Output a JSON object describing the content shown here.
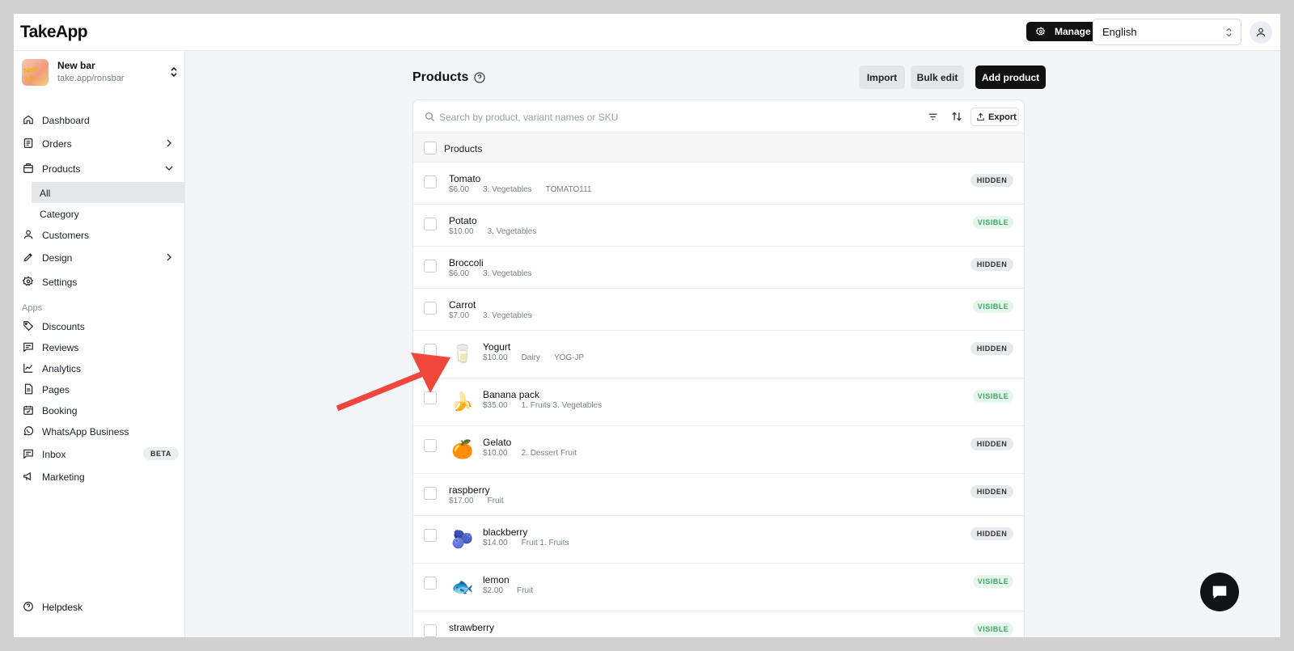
{
  "app": {
    "logo": "TakeApp"
  },
  "topbar": {
    "manage_label": "Manage",
    "language": "English"
  },
  "store": {
    "name": "New bar",
    "url": "take.app/ronsbar",
    "avatar_text": "New bar"
  },
  "sidebar": {
    "items": [
      {
        "label": "Dashboard",
        "icon": "home-icon"
      },
      {
        "label": "Orders",
        "icon": "orders-icon"
      },
      {
        "label": "Products",
        "icon": "products-icon"
      },
      {
        "label": "Customers",
        "icon": "user-icon"
      },
      {
        "label": "Design",
        "icon": "pen-icon"
      },
      {
        "label": "Settings",
        "icon": "gear-icon"
      }
    ],
    "sub_items": [
      {
        "label": "All"
      },
      {
        "label": "Category"
      }
    ],
    "apps_label": "Apps",
    "apps": [
      {
        "label": "Discounts",
        "icon": "tag-icon"
      },
      {
        "label": "Reviews",
        "icon": "review-icon"
      },
      {
        "label": "Analytics",
        "icon": "chart-icon"
      },
      {
        "label": "Pages",
        "icon": "page-icon"
      },
      {
        "label": "Booking",
        "icon": "calendar-icon"
      },
      {
        "label": "WhatsApp Business",
        "icon": "whatsapp-icon"
      },
      {
        "label": "Inbox",
        "icon": "inbox-icon",
        "badge": "BETA"
      },
      {
        "label": "Marketing",
        "icon": "megaphone-icon"
      }
    ],
    "helpdesk": "Helpdesk"
  },
  "main": {
    "title": "Products",
    "import_label": "Import",
    "bulk_edit_label": "Bulk edit",
    "add_product_label": "Add product",
    "search_placeholder": "Search by product, variant names or SKU",
    "export_label": "Export",
    "column_header": "Products",
    "products": [
      {
        "name": "Tomato",
        "price": "$6.00",
        "categories": "3. Vegetables",
        "sku": "TOMATO111",
        "status": "HIDDEN"
      },
      {
        "name": "Potato",
        "price": "$10.00",
        "categories": "3. Vegetables",
        "sku": "",
        "status": "VISIBLE"
      },
      {
        "name": "Broccoli",
        "price": "$6.00",
        "categories": "3. Vegetables",
        "sku": "",
        "status": "HIDDEN"
      },
      {
        "name": "Carrot",
        "price": "$7.00",
        "categories": "3. Vegetables",
        "sku": "",
        "status": "VISIBLE"
      },
      {
        "name": "Yogurt",
        "price": "$10.00",
        "categories": "Dairy",
        "sku": "YOG-JP",
        "status": "HIDDEN",
        "thumb": "🥛"
      },
      {
        "name": "Banana pack",
        "price": "$35.00",
        "categories": "1. Fruits 3. Vegetables",
        "sku": "",
        "status": "VISIBLE",
        "thumb": "🍌"
      },
      {
        "name": "Gelato",
        "price": "$10.00",
        "categories": "2. Dessert Fruit",
        "sku": "",
        "status": "HIDDEN",
        "thumb": "🍊"
      },
      {
        "name": "raspberry",
        "price": "$17.00",
        "categories": "Fruit",
        "sku": "",
        "status": "HIDDEN"
      },
      {
        "name": "blackberry",
        "price": "$14.00",
        "categories": "Fruit 1. Fruits",
        "sku": "",
        "status": "HIDDEN",
        "thumb": "🫐"
      },
      {
        "name": "lemon",
        "price": "$2.00",
        "categories": "Fruit",
        "sku": "",
        "status": "VISIBLE",
        "thumb": "🐟"
      },
      {
        "name": "strawberry",
        "price": "",
        "categories": "",
        "sku": "",
        "status": "VISIBLE"
      }
    ]
  },
  "colors": {
    "accent_dark": "#111111",
    "visible_green": "#3ca663",
    "annotation_red": "#f0463c"
  }
}
